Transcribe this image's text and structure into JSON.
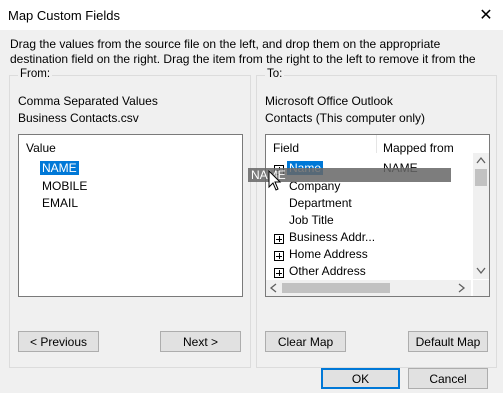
{
  "window": {
    "title": "Map Custom Fields",
    "close_glyph": "✕"
  },
  "instructions": {
    "line1": "Drag the values from the source file on the left, and drop them on the appropriate",
    "line2": "destination field on the right.  Drag the item from the right to the left to remove it from the"
  },
  "from": {
    "caption": "From:",
    "source_type": "Comma Separated Values",
    "source_file": "Business Contacts.csv",
    "list_header": "Value",
    "items": [
      "NAME",
      "MOBILE",
      "EMAIL"
    ],
    "previous_label": "< Previous",
    "next_label": "Next >"
  },
  "to": {
    "caption": "To:",
    "target_app": "Microsoft Office Outlook",
    "target_folder": "Contacts (This computer only)",
    "col_field": "Field",
    "col_mapped": "Mapped from",
    "rows": [
      {
        "field": "Name",
        "mapped": "NAME",
        "expandable": true
      },
      {
        "field": "Company",
        "mapped": "",
        "expandable": false
      },
      {
        "field": "Department",
        "mapped": "",
        "expandable": false
      },
      {
        "field": "Job Title",
        "mapped": "",
        "expandable": false
      },
      {
        "field": "Business Addr...",
        "mapped": "",
        "expandable": true
      },
      {
        "field": "Home Address",
        "mapped": "",
        "expandable": true
      },
      {
        "field": "Other Address",
        "mapped": "",
        "expandable": true
      }
    ],
    "clear_map_label": "Clear Map",
    "default_map_label": "Default Map"
  },
  "drag_ghost_text": "NAME",
  "footer": {
    "ok_label": "OK",
    "cancel_label": "Cancel"
  },
  "colors": {
    "selection": "#0078d7",
    "window_bg": "#f0f0f0"
  }
}
